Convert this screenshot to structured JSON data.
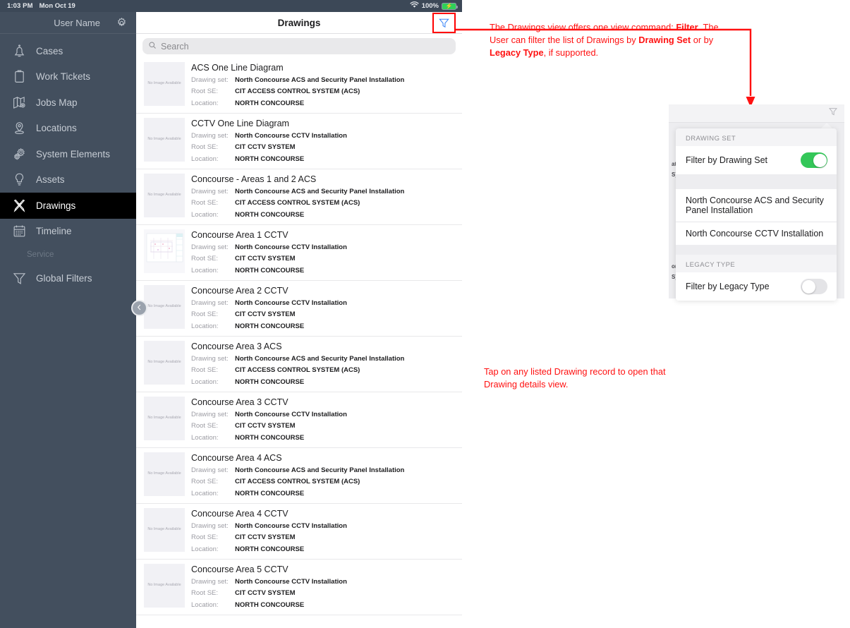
{
  "status_bar": {
    "time": "1:03 PM",
    "date": "Mon Oct 19",
    "battery_pct": "100%",
    "wifi_icon": "wifi-icon",
    "battery_icon": "battery-charging-icon"
  },
  "sidebar": {
    "user_name": "User Name",
    "settings_icon": "gear-icon",
    "collapse_icon": "chevron-left-circle-icon",
    "items": [
      {
        "label": "Cases",
        "icon": "bell-icon",
        "active": false
      },
      {
        "label": "Work Tickets",
        "icon": "clipboard-icon",
        "active": false
      },
      {
        "label": "Jobs Map",
        "icon": "map-pin-icon",
        "active": false
      },
      {
        "label": "Locations",
        "icon": "location-marker-icon",
        "active": false
      },
      {
        "label": "System Elements",
        "icon": "gears-icon",
        "active": false
      },
      {
        "label": "Assets",
        "icon": "lightbulb-icon",
        "active": false
      },
      {
        "label": "Drawings",
        "icon": "drafting-tools-icon",
        "active": true
      },
      {
        "label": "Timeline",
        "icon": "calendar-icon",
        "active": false
      }
    ],
    "section_label": "Service",
    "service_items": [
      {
        "label": "Global Filters",
        "icon": "funnel-icon",
        "active": false
      }
    ]
  },
  "pane": {
    "title": "Drawings",
    "filter_icon": "funnel-icon",
    "search": {
      "placeholder": "Search",
      "value": "",
      "icon": "search-icon"
    },
    "field_labels": {
      "drawing_set": "Drawing set:",
      "root_se": "Root SE:",
      "location": "Location:"
    },
    "thumb_placeholder": "No Image Available",
    "rows": [
      {
        "title": "ACS One Line Diagram",
        "drawing_set": "North Concourse ACS and Security Panel Installation",
        "root_se": "CIT ACCESS CONTROL SYSTEM (ACS)",
        "location": "NORTH CONCOURSE",
        "has_preview": false
      },
      {
        "title": "CCTV One Line Diagram",
        "drawing_set": "North Concourse CCTV Installation",
        "root_se": "CIT CCTV SYSTEM",
        "location": "NORTH CONCOURSE",
        "has_preview": false
      },
      {
        "title": "Concourse - Areas 1 and 2 ACS",
        "drawing_set": "North Concourse ACS and Security Panel Installation",
        "root_se": "CIT ACCESS CONTROL SYSTEM (ACS)",
        "location": "NORTH CONCOURSE",
        "has_preview": false
      },
      {
        "title": "Concourse Area 1 CCTV",
        "drawing_set": "North Concourse CCTV Installation",
        "root_se": "CIT CCTV SYSTEM",
        "location": "NORTH CONCOURSE",
        "has_preview": true
      },
      {
        "title": "Concourse Area 2 CCTV",
        "drawing_set": "North Concourse CCTV Installation",
        "root_se": "CIT CCTV SYSTEM",
        "location": "NORTH CONCOURSE",
        "has_preview": false
      },
      {
        "title": "Concourse Area 3 ACS",
        "drawing_set": "North Concourse ACS and Security Panel Installation",
        "root_se": "CIT ACCESS CONTROL SYSTEM (ACS)",
        "location": "NORTH CONCOURSE",
        "has_preview": false
      },
      {
        "title": "Concourse Area 3 CCTV",
        "drawing_set": "North Concourse CCTV Installation",
        "root_se": "CIT CCTV SYSTEM",
        "location": "NORTH CONCOURSE",
        "has_preview": false
      },
      {
        "title": "Concourse Area 4 ACS",
        "drawing_set": "North Concourse ACS and Security Panel Installation",
        "root_se": "CIT ACCESS CONTROL SYSTEM (ACS)",
        "location": "NORTH CONCOURSE",
        "has_preview": false
      },
      {
        "title": "Concourse Area 4 CCTV",
        "drawing_set": "North Concourse CCTV Installation",
        "root_se": "CIT CCTV SYSTEM",
        "location": "NORTH CONCOURSE",
        "has_preview": false
      },
      {
        "title": "Concourse Area 5 CCTV",
        "drawing_set": "North Concourse CCTV Installation",
        "root_se": "CIT CCTV SYSTEM",
        "location": "NORTH CONCOURSE",
        "has_preview": false
      }
    ]
  },
  "filter_popover": {
    "filter_icon": "funnel-icon",
    "drawing_set_header": "DRAWING SET",
    "drawing_set_toggle_label": "Filter by Drawing Set",
    "drawing_set_toggle_on": true,
    "drawing_set_options": [
      "North Concourse ACS and Security Panel Installation",
      "North Concourse CCTV Installation"
    ],
    "legacy_type_header": "LEGACY TYPE",
    "legacy_type_toggle_label": "Filter by Legacy Type",
    "legacy_type_toggle_on": false
  },
  "annotations": {
    "accent_color": "#ff1111",
    "note_1": {
      "part_1": "The Drawings view offers one view command: ",
      "bold_1": "Filter",
      "part_2": ". The User can filter the list of Drawings by ",
      "bold_2": "Drawing Set",
      "part_3": " or by ",
      "bold_3": "Legacy Type",
      "part_4": ", if supported."
    },
    "note_2": "Tap on any listed Drawing record to open that Drawing details view."
  }
}
